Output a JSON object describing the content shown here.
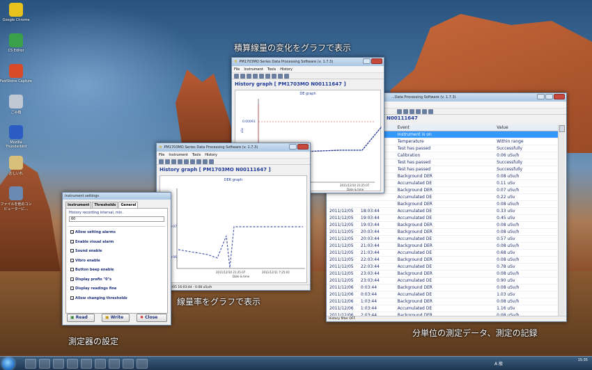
{
  "annotations": {
    "top": "積算線量の変化をグラフで表示",
    "middle": "線量率をグラフで表示",
    "left": "測定器の設定",
    "right": "分単位の測定データ、測定の記録"
  },
  "desktop_icons": [
    {
      "label": "Google Chrome",
      "icon": "chrome-icon"
    },
    {
      "label": "CS Editor",
      "icon": "editor-icon"
    },
    {
      "label": "FastStone Capture",
      "icon": "capture-icon"
    },
    {
      "label": "ごみ箱",
      "icon": "recycle-bin-icon"
    },
    {
      "label": "Mozilla Thunderbird",
      "icon": "thunderbird-icon"
    },
    {
      "label": "おしいれ",
      "icon": "folder-icon"
    },
    {
      "label": "ファイルを他のコンピューターに...",
      "icon": "computer-icon"
    }
  ],
  "de_window": {
    "title": "PM1703MO Series Data Processing Software (v. 1.7.3)",
    "menu": [
      "File",
      "Instrument",
      "Tools",
      "History"
    ],
    "heading": "History graph [ PM1703MO N00111647 ]",
    "graph_title": "DE graph",
    "y_tick": "0.00093",
    "x_tick": "2011/12/10 21:25:07",
    "x_label": "Date & time",
    "y_label": "uSv"
  },
  "der_window": {
    "title": "PM1703MO Series Data Processing Software (v. 1.7.3)",
    "menu": [
      "File",
      "Instrument",
      "Tools",
      "History"
    ],
    "heading": "History graph [ PM1703MO N00111647 ]",
    "graph_title": "DER graph",
    "y_ticks": [
      "0.07",
      "0.06"
    ],
    "x_ticks": [
      "2011/12/10 21:25:07",
      "2011/12/11 7:25:02"
    ],
    "x_label": "Date & time",
    "status": "2011/12/05 16:03:44 - 0.08 uSv/h"
  },
  "events_window": {
    "title": "...Data Processing Software (v. 1.7.3)",
    "heading": "N00111647",
    "columns": [
      "Event",
      "Value"
    ],
    "rows": [
      {
        "date": "",
        "time": "",
        "event": "Instrument is on",
        "value": ""
      },
      {
        "date": "",
        "time": "",
        "event": "Temperature",
        "value": "Within range"
      },
      {
        "date": "",
        "time": "",
        "event": "Test has passed",
        "value": "Successfully"
      },
      {
        "date": "",
        "time": "",
        "event": "Calibration",
        "value": "0.06 uSv/h"
      },
      {
        "date": "",
        "time": "",
        "event": "Test has passed",
        "value": "Successfully"
      },
      {
        "date": "",
        "time": "",
        "event": "Test has passed",
        "value": "Successfully"
      },
      {
        "date": "",
        "time": "",
        "event": "Background DER",
        "value": "0.08 uSv/h"
      },
      {
        "date": "",
        "time": "",
        "event": "Accumulated DE",
        "value": "0.11 uSv"
      },
      {
        "date": "",
        "time": "",
        "event": "Background DER",
        "value": "0.07 uSv/h"
      },
      {
        "date": "",
        "time": "",
        "event": "Accumulated DE",
        "value": "0.22 uSv"
      },
      {
        "date": "",
        "time": "",
        "event": "Background DER",
        "value": "0.08 uSv/h"
      },
      {
        "date": "2011/12/05",
        "time": "18:03:44",
        "event": "Accumulated DE",
        "value": "0.33 uSv"
      },
      {
        "date": "2011/12/05",
        "time": "19:03:44",
        "event": "Accumulated DE",
        "value": "0.45 uSv"
      },
      {
        "date": "2011/12/05",
        "time": "19:03:44",
        "event": "Background DER",
        "value": "0.08 uSv/h"
      },
      {
        "date": "2011/12/05",
        "time": "20:03:44",
        "event": "Background DER",
        "value": "0.08 uSv/h"
      },
      {
        "date": "2011/12/05",
        "time": "20:03:44",
        "event": "Accumulated DE",
        "value": "0.57 uSv"
      },
      {
        "date": "2011/12/05",
        "time": "21:03:44",
        "event": "Background DER",
        "value": "0.08 uSv/h"
      },
      {
        "date": "2011/12/05",
        "time": "21:03:44",
        "event": "Accumulated DE",
        "value": "0.68 uSv"
      },
      {
        "date": "2011/12/05",
        "time": "22:03:44",
        "event": "Background DER",
        "value": "0.08 uSv/h"
      },
      {
        "date": "2011/12/05",
        "time": "22:03:44",
        "event": "Accumulated DE",
        "value": "0.78 uSv"
      },
      {
        "date": "2011/12/05",
        "time": "23:03:44",
        "event": "Background DER",
        "value": "0.08 uSv/h"
      },
      {
        "date": "2011/12/05",
        "time": "23:03:44",
        "event": "Accumulated DE",
        "value": "0.90 uSv"
      },
      {
        "date": "2011/12/06",
        "time": "0:03:44",
        "event": "Background DER",
        "value": "0.08 uSv/h"
      },
      {
        "date": "2011/12/06",
        "time": "0:03:44",
        "event": "Accumulated DE",
        "value": "1.03 uSv"
      },
      {
        "date": "2011/12/06",
        "time": "1:03:44",
        "event": "Background DER",
        "value": "0.08 uSv/h"
      },
      {
        "date": "2011/12/06",
        "time": "1:03:44",
        "event": "Accumulated DE",
        "value": "1.16 uSv"
      },
      {
        "date": "2011/12/06",
        "time": "2:03:44",
        "event": "Background DER",
        "value": "0.08 uSv/h"
      }
    ],
    "status": "History filter OFF"
  },
  "settings_window": {
    "title": "Instrument settings",
    "tabs": [
      "Instrument",
      "Thresholds",
      "General"
    ],
    "interval_label": "History recording interval, min.",
    "interval_value": "60",
    "options": [
      {
        "label": "Allow setting alarms",
        "checked": true
      },
      {
        "label": "Enable visual alarm",
        "checked": true
      },
      {
        "label": "Sound enable",
        "checked": true
      },
      {
        "label": "Vibro enable",
        "checked": true
      },
      {
        "label": "Button beep enable",
        "checked": false
      },
      {
        "label": "Display prefix \"0\"s",
        "checked": true
      },
      {
        "label": "Display readings fine",
        "checked": true
      },
      {
        "label": "Allow changing thresholds",
        "checked": true
      }
    ],
    "buttons": {
      "read": "Read",
      "write": "Write",
      "close": "Close"
    }
  },
  "taskbar": {
    "time": "15:35",
    "tray_text": "A 般"
  },
  "colors": {
    "accent": "#1f3a9a",
    "selection": "#3399ff"
  }
}
